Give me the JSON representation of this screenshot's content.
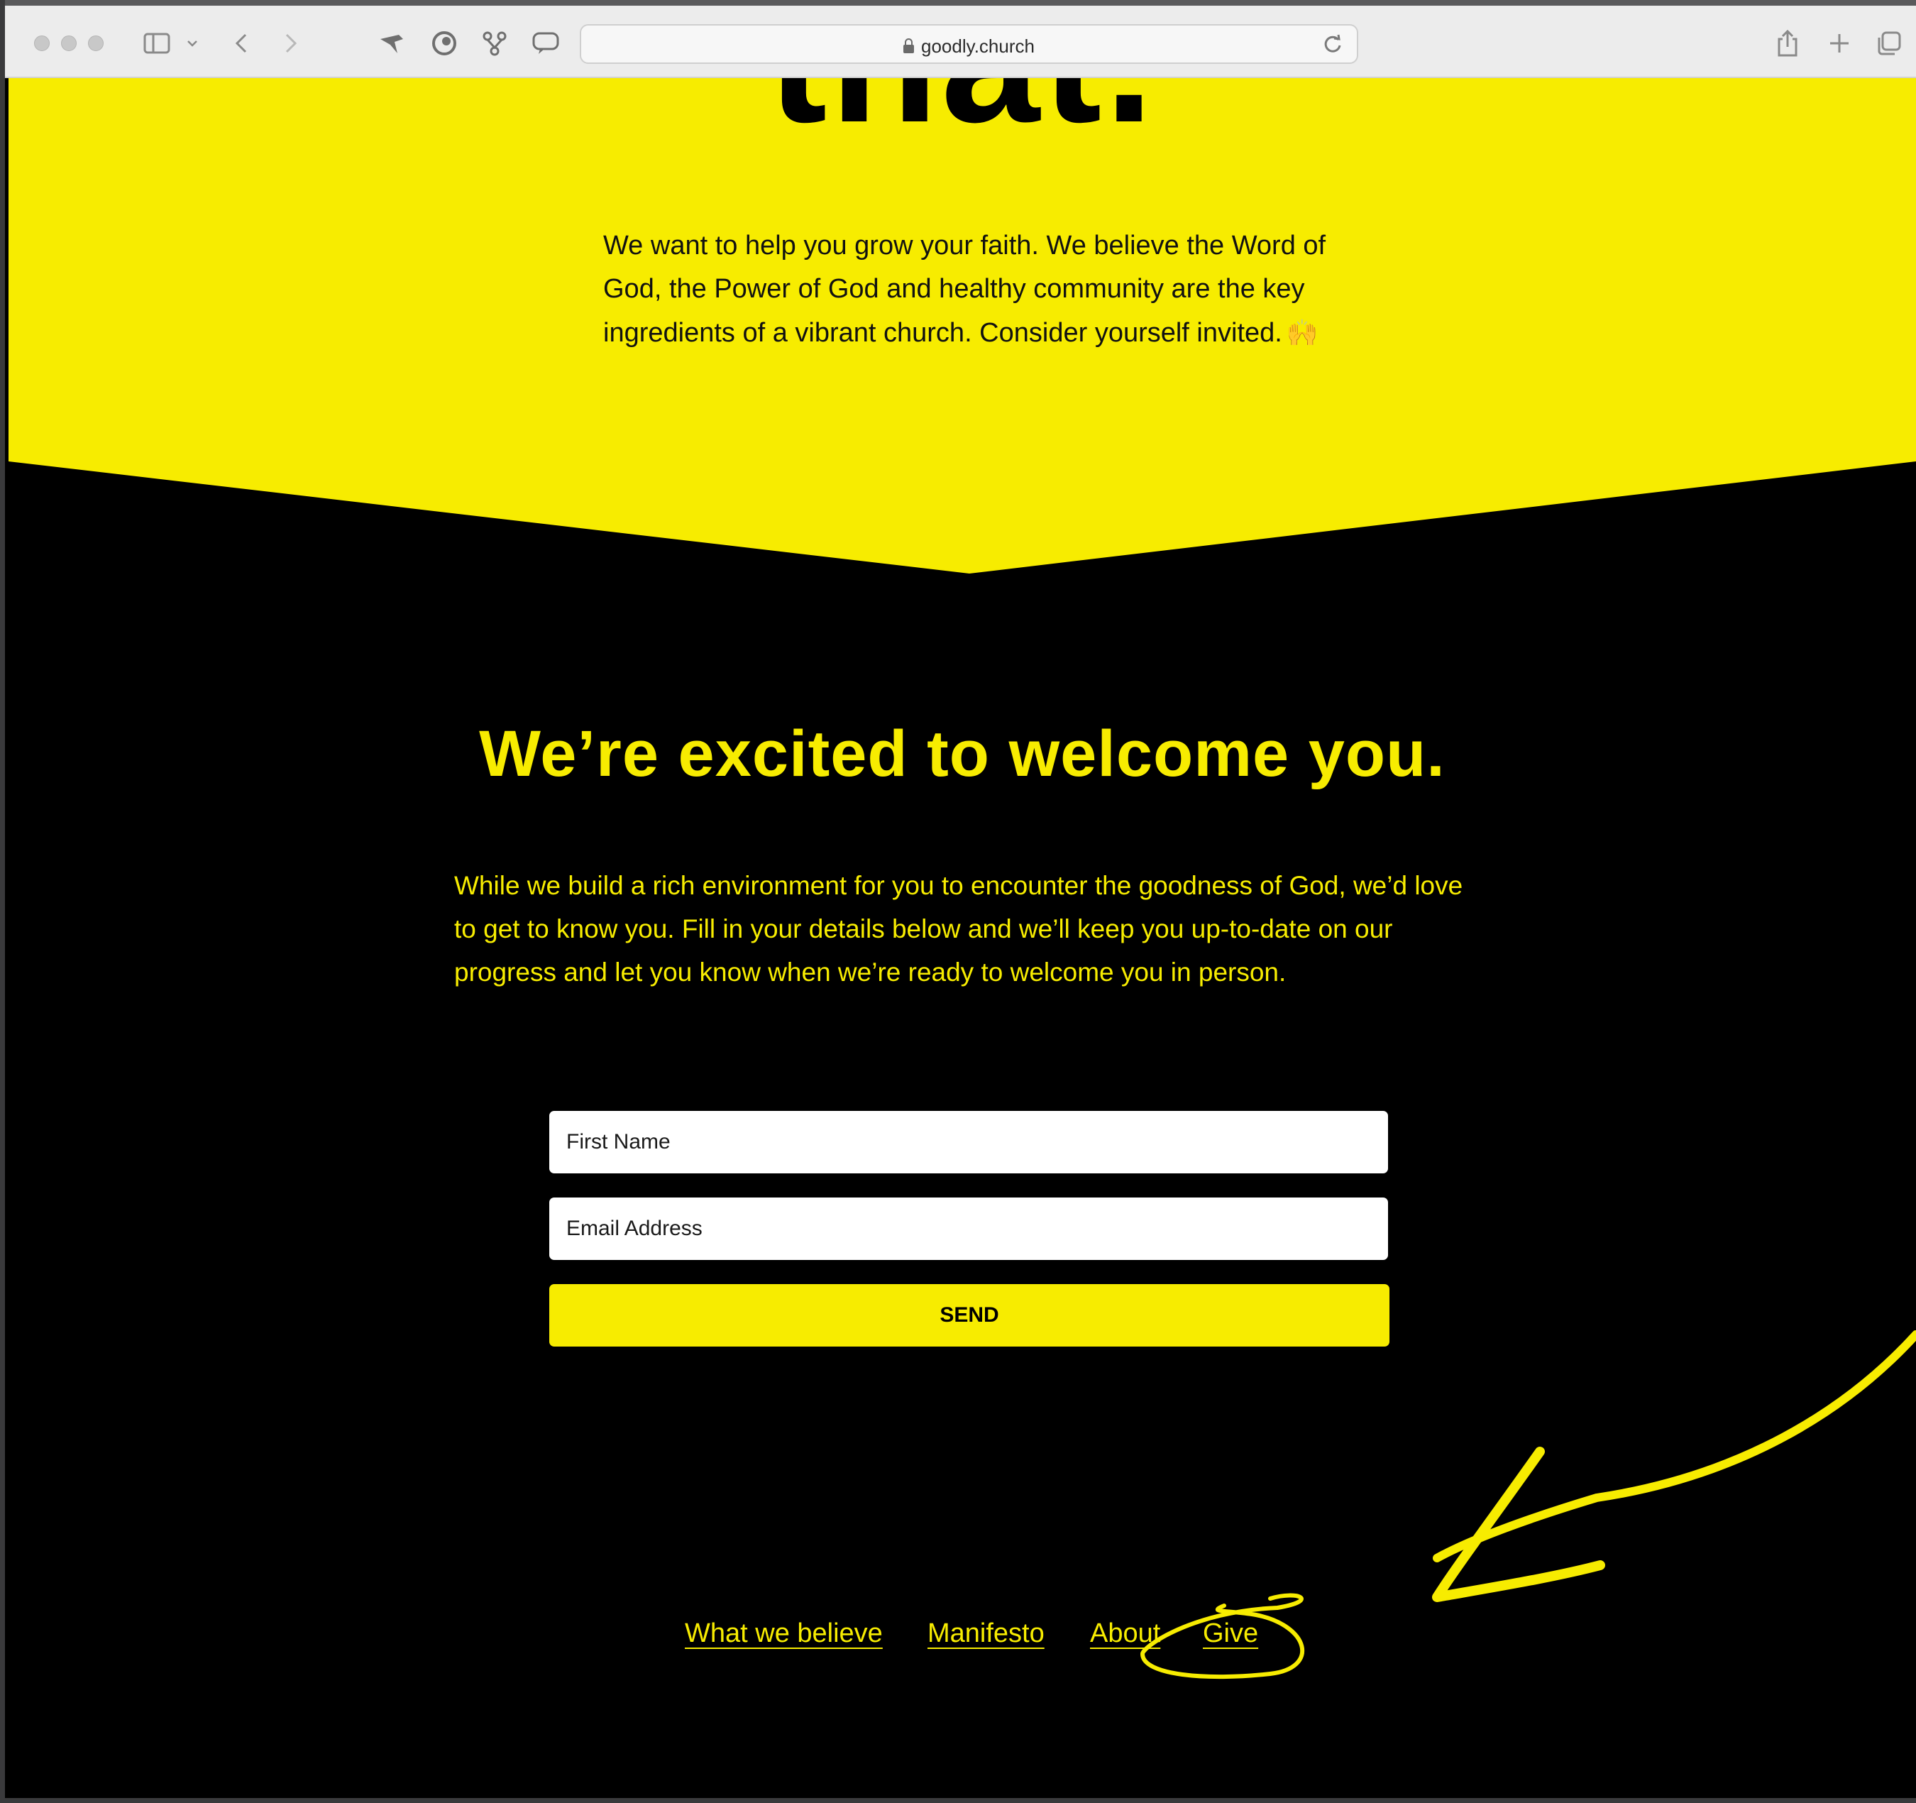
{
  "browser": {
    "url": "goodly.church"
  },
  "hero": {
    "heading_fragment": "that.",
    "text": "We want to help you grow your faith. We believe the Word of God, the Power of God and healthy community are the key ingredients of a vibrant church. Consider yourself invited.",
    "emoji": "🙌"
  },
  "welcome": {
    "title": "We’re excited to welcome you.",
    "text": "While we build a rich environment for you to encounter the goodness of God, we’d love to get to know you. Fill in your details below and we’ll keep you up-to-date on our progress and let you know when we’re ready to welcome you in person."
  },
  "form": {
    "first_name_placeholder": "First Name",
    "email_placeholder": "Email Address",
    "send_label": "SEND"
  },
  "footer": {
    "links": [
      "What we believe",
      "Manifesto",
      "About",
      "Give"
    ]
  },
  "colors": {
    "brand_yellow": "#f7ec00",
    "background": "#000000"
  }
}
